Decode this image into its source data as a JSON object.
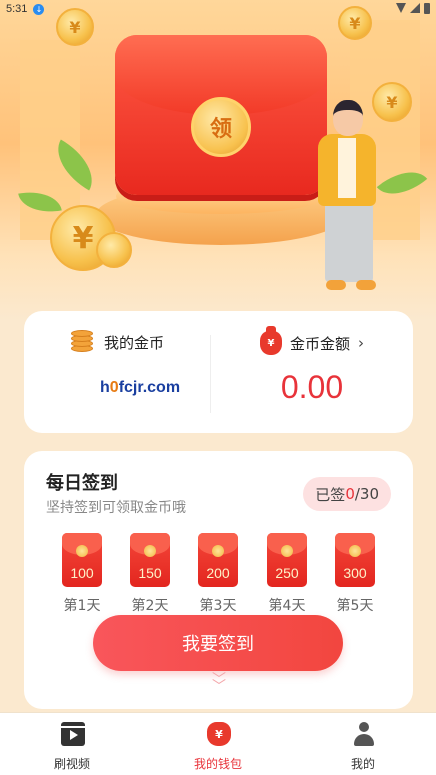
{
  "status_bar": {
    "time": "5:31"
  },
  "hero": {
    "seal_char": "领",
    "coin_symbol": "¥"
  },
  "coins_card": {
    "coins_label": "我的金币",
    "coins_value_prefix": "h",
    "coins_value_o": "0",
    "coins_value_rest": "fcjr.com",
    "amount_label": "金币金额",
    "amount_value": "0.00",
    "amount_chevron": "›"
  },
  "sign_in": {
    "title": "每日签到",
    "subtitle": "坚持签到可领取金币哦",
    "badge_prefix": "已签",
    "badge_count": "0",
    "badge_total": "/30",
    "days": [
      {
        "value": "100",
        "label": "第1天"
      },
      {
        "value": "150",
        "label": "第2天"
      },
      {
        "value": "200",
        "label": "第3天"
      },
      {
        "value": "250",
        "label": "第4天"
      },
      {
        "value": "300",
        "label": "第5天"
      }
    ],
    "button_label": "我要签到"
  },
  "tabbar": {
    "items": [
      {
        "label": "刷视频",
        "icon": "video-icon"
      },
      {
        "label": "我的钱包",
        "icon": "wallet-icon",
        "icon_char": "¥",
        "active": true
      },
      {
        "label": "我的",
        "icon": "user-icon"
      }
    ]
  },
  "colors": {
    "accent": "#e8333a",
    "background": "#fbe9cf"
  }
}
